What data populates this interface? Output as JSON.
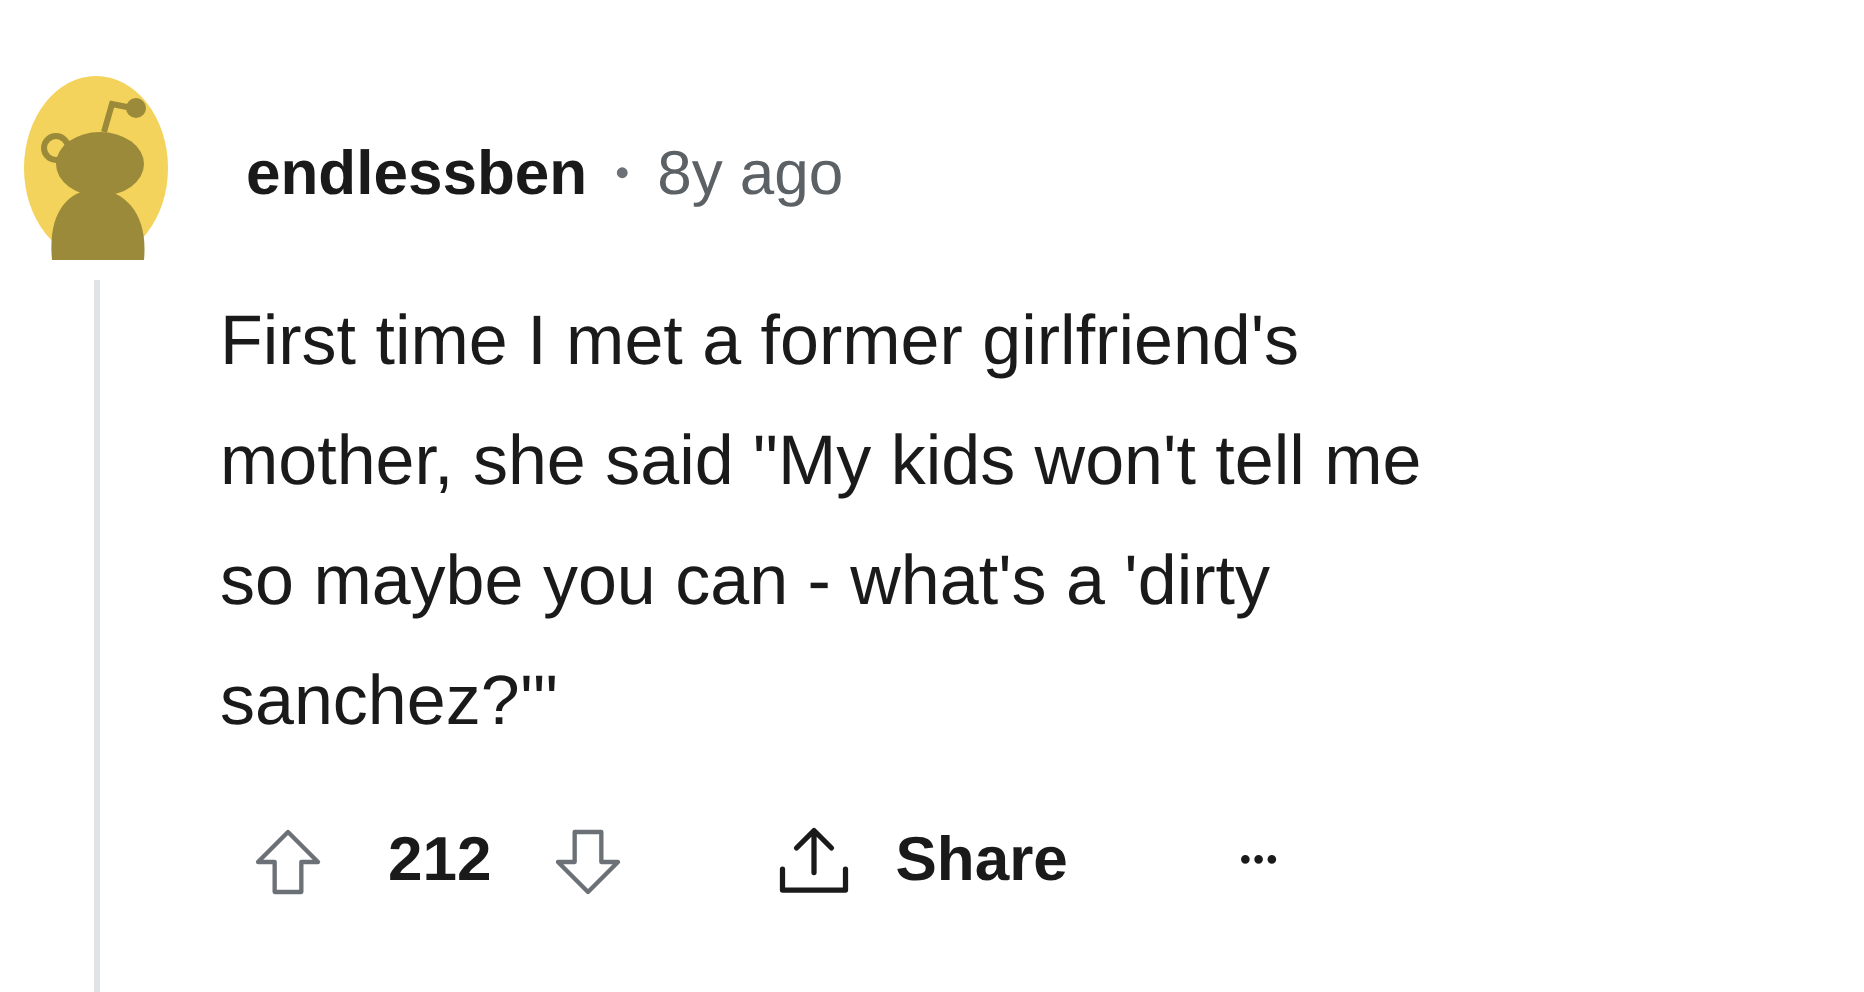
{
  "comment": {
    "author": "endlessben",
    "separator": "•",
    "time": "8y ago",
    "body_lines": [
      "First time I met a former girlfriend's",
      "mother, she said \"My kids won't tell me",
      "so maybe you can - what's a 'dirty",
      "sanchez?'\""
    ],
    "score": "212",
    "share_label": "Share",
    "more": "•••"
  }
}
